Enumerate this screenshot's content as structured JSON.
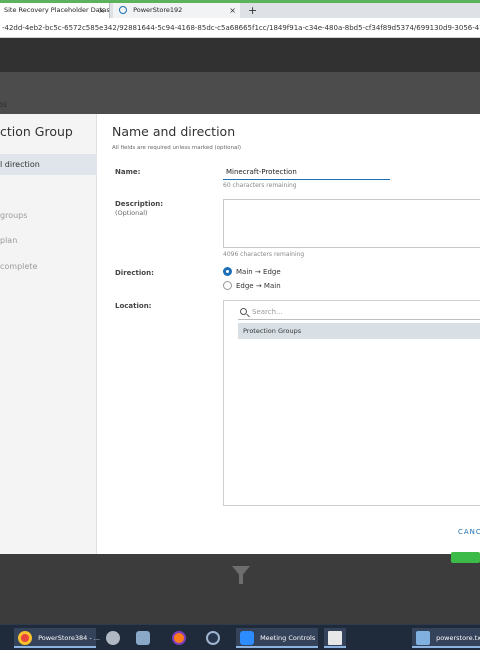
{
  "browser": {
    "tabs": [
      {
        "label": "Site Recovery Placeholder Datast",
        "close": "×"
      },
      {
        "label": "PowerStore192",
        "close": "×"
      }
    ],
    "new_tab": "+",
    "url": "-42dd-4eb2-bc5c-6572c585e342/92881644-5c94-4168-85dc-c5a68665f1cc/1849f91a-c34e-480a-8bd5-cf34f89d5374/699130d9-3056-47a1-954"
  },
  "app": {
    "breadcrumb": "os"
  },
  "wizard": {
    "title": "ction Group",
    "steps": [
      {
        "label": "l direction"
      },
      {
        "label": "groups"
      },
      {
        "label": "plan"
      },
      {
        "label": "complete"
      }
    ]
  },
  "page": {
    "heading": "Name and direction",
    "note": "All fields are required unless marked (optional)",
    "name_label": "Name:",
    "name_value": "Minecraft-Protection",
    "name_hint": "60 characters remaining",
    "description_label": "Description:",
    "description_optional": "(Optional)",
    "description_hint": "4096 characters remaining",
    "direction_label": "Direction:",
    "direction_options": [
      {
        "label": "Main → Edge",
        "selected": true
      },
      {
        "label": "Edge → Main",
        "selected": false
      }
    ],
    "location_label": "Location:",
    "search_placeholder": "Search...",
    "tree_item": "Protection Groups",
    "cancel_label": "CANC"
  },
  "taskbar": {
    "items": [
      {
        "label": "PowerStore384 - ..."
      },
      {
        "label": "Meeting Controls"
      },
      {
        "label": "powerstore.txt -"
      }
    ]
  },
  "colors": {
    "accent": "#1c6fb6",
    "go": "#3dbb48"
  }
}
